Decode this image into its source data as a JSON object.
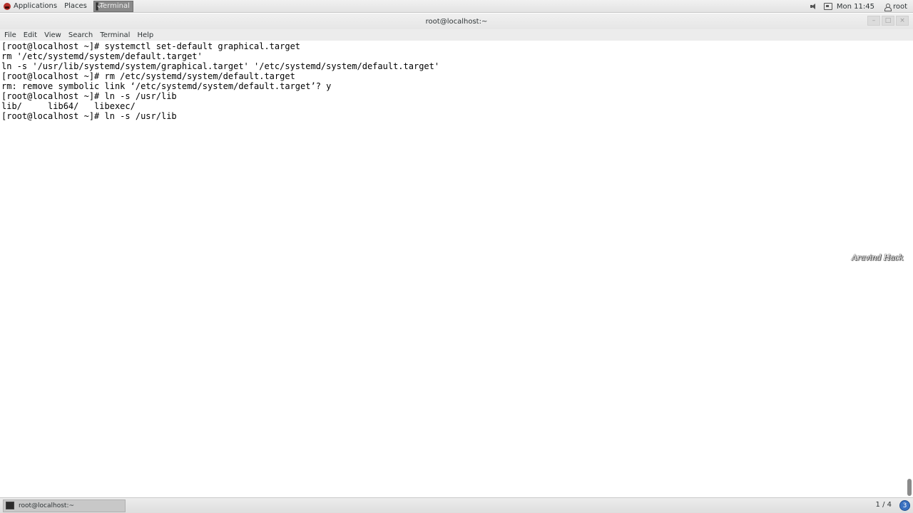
{
  "top_panel": {
    "applications_label": "Applications",
    "places_label": "Places",
    "taskbar_label": "Terminal",
    "clock": "Mon 11:45",
    "user": "root"
  },
  "window": {
    "title": "root@localhost:~",
    "minimize_glyph": "–",
    "maximize_glyph": "□",
    "close_glyph": "×"
  },
  "menubar": {
    "items": [
      "File",
      "Edit",
      "View",
      "Search",
      "Terminal",
      "Help"
    ]
  },
  "terminal": {
    "lines": [
      "[root@localhost ~]# systemctl set-default graphical.target",
      "rm '/etc/systemd/system/default.target'",
      "ln -s '/usr/lib/systemd/system/graphical.target' '/etc/systemd/system/default.target'",
      "[root@localhost ~]# rm /etc/systemd/system/default.target",
      "rm: remove symbolic link ‘/etc/systemd/system/default.target’? y",
      "[root@localhost ~]# ln -s /usr/lib",
      "lib/     lib64/   libexec/",
      "[root@localhost ~]# ln -s /usr/lib"
    ]
  },
  "watermark": "Aravind Hack",
  "bottom_panel": {
    "task_label": "root@localhost:~",
    "workspace": "1 / 4",
    "notification_count": "3"
  },
  "icons": {
    "apps": "red-hat-icon",
    "terminal": "terminal-icon",
    "volume": "volume-icon",
    "network": "network-icon",
    "user": "user-icon",
    "notification": "notification-icon"
  },
  "colors": {
    "terminal_bg": "#ffffff",
    "terminal_fg": "#000000",
    "notification_badge": "#3a71c1"
  }
}
